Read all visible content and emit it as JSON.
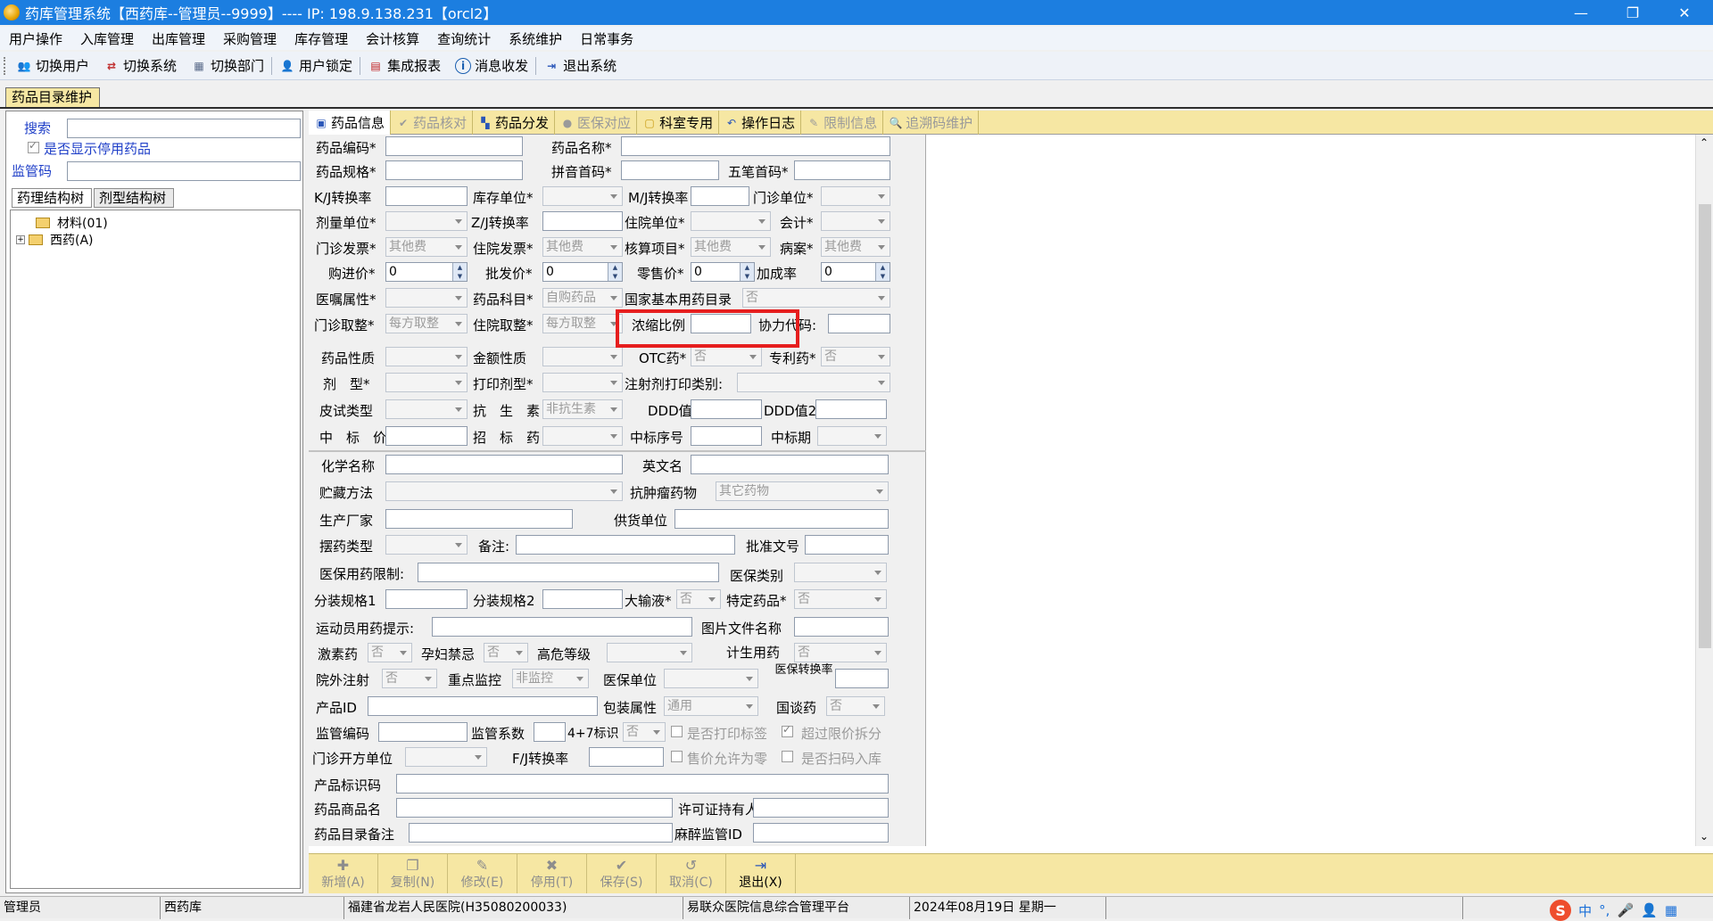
{
  "window": {
    "title": "药库管理系统【西药库--管理员--9999】---- IP: 198.9.138.231【orcl2】",
    "min": "—",
    "restore": "❐",
    "close": "✕"
  },
  "menu": [
    "用户操作",
    "入库管理",
    "出库管理",
    "采购管理",
    "库存管理",
    "会计核算",
    "查询统计",
    "系统维护",
    "日常事务"
  ],
  "toolbar": [
    {
      "label": "切换用户",
      "icon": "users-icon"
    },
    {
      "label": "切换系统",
      "icon": "switch-system-icon"
    },
    {
      "label": "切换部门",
      "icon": "department-icon"
    },
    {
      "label": "用户锁定",
      "icon": "lock-user-icon"
    },
    {
      "label": "集成报表",
      "icon": "report-icon"
    },
    {
      "label": "消息收发",
      "icon": "info-icon"
    },
    {
      "label": "退出系统",
      "icon": "exit-icon"
    }
  ],
  "doc_tab": "药品目录维护",
  "left": {
    "search_label": "搜索",
    "show_disabled_label": "是否显示停用药品",
    "regcode_label": "监管码",
    "tab_pharm": "药理结构树",
    "tab_form": "剂型结构树",
    "tree": [
      "材料(01)",
      "西药(A)"
    ]
  },
  "tabs": [
    {
      "label": "药品信息",
      "state": "active"
    },
    {
      "label": "药品核对",
      "state": "disabled"
    },
    {
      "label": "药品分发",
      "state": "normal"
    },
    {
      "label": "医保对应",
      "state": "disabled"
    },
    {
      "label": "科室专用",
      "state": "normal"
    },
    {
      "label": "操作日志",
      "state": "normal"
    },
    {
      "label": "限制信息",
      "state": "disabled"
    },
    {
      "label": "追溯码维护",
      "state": "disabled"
    }
  ],
  "form": {
    "code": "药品编码*",
    "name": "药品名称*",
    "spec": "药品规格*",
    "pinyin": "拼音首码*",
    "wubi": "五笔首码*",
    "kj": "K/J转换率",
    "stockunit": "库存单位*",
    "mj": "M/J转换率",
    "opunit": "门诊单位*",
    "doseunit": "剂量单位*",
    "zj": "Z/J转换率",
    "ipunit": "住院单位*",
    "acct": "会计*",
    "opinv": "门诊发票*",
    "opinv_val": "其他费",
    "ipinv": "住院发票*",
    "ipinv_val": "其他费",
    "calc": "核算项目*",
    "calc_val": "其他费",
    "case": "病案*",
    "case_val": "其他费",
    "buy": "购进价*",
    "buy_val": "0",
    "whole": "批发价*",
    "whole_val": "0",
    "retail": "零售价*",
    "retail_val": "0",
    "markup": "加成率",
    "markup_val": "0",
    "order": "医嘱属性*",
    "subject": "药品科目*",
    "subject_val": "自购药品",
    "basic": "国家基本用药目录",
    "basic_val": "否",
    "opround": "门诊取整*",
    "opround_val": "每方取整",
    "ipround": "住院取整*",
    "ipround_val": "每方取整",
    "conc": "浓缩比例",
    "cooper": "协力代码:",
    "nature": "药品性质",
    "amount": "金额性质",
    "otc": "OTC药*",
    "otc_val": "否",
    "patent": "专利药*",
    "patent_val": "否",
    "dosage": "剂　型*",
    "printdose": "打印剂型*",
    "inject": "注射剂打印类别:",
    "skin": "皮试类型",
    "anti": "抗　生　素",
    "anti_val": "非抗生素",
    "ddd": "DDD值",
    "ddd2": "DDD值2",
    "bidprice": "中　标　价",
    "bidding": "招　标　药",
    "bidno": "中标序号",
    "bidperiod": "中标期",
    "chem": "化学名称",
    "eng": "英文名",
    "storage": "贮藏方法",
    "tumor": "抗肿瘤药物",
    "tumor_val": "其它药物",
    "maker": "生产厂家",
    "supplier": "供货单位",
    "display": "摆药类型",
    "remark": "备注:",
    "approval": "批准文号",
    "insurance_limit": "医保用药限制:",
    "insurance_cat": "医保类别",
    "pack1": "分装规格1",
    "pack2": "分装规格2",
    "infusion": "大输液*",
    "infusion_val": "否",
    "special": "特定药品*",
    "special_val": "否",
    "athlete": "运动员用药提示:",
    "image": "图片文件名称",
    "hormone": "激素药",
    "hormone_val": "否",
    "pregnant": "孕妇禁忌",
    "pregnant_val": "否",
    "risk": "高危等级",
    "family": "计生用药",
    "family_val": "否",
    "extinj": "院外注射",
    "extinj_val": "否",
    "monitor": "重点监控",
    "monitor_val": "非监控",
    "insunit": "医保单位",
    "insconv": "医保转换率",
    "pid": "产品ID",
    "packattr": "包装属性",
    "packattr_val": "通用",
    "nego": "国谈药",
    "nego_val": "否",
    "regcode": "监管编码",
    "regcoef": "监管系数",
    "mark47": "4+7标识",
    "mark47_val": "否",
    "printlabel": "是否打印标签",
    "overlimit": "超过限价拆分",
    "opunit2": "门诊开方单位",
    "fj": "F/J转换率",
    "zero": "售价允许为零",
    "scanin": "是否扫码入库",
    "prodcode": "产品标识码",
    "trade": "药品商品名",
    "licensee": "许可证持有人",
    "catremark": "药品目录备注",
    "narcotic": "麻醉监管ID"
  },
  "buttons": [
    {
      "label": "新增(A)",
      "icon": "add-icon",
      "enabled": false
    },
    {
      "label": "复制(N)",
      "icon": "copy-icon",
      "enabled": false
    },
    {
      "label": "修改(E)",
      "icon": "edit-icon",
      "enabled": false
    },
    {
      "label": "停用(T)",
      "icon": "disable-icon",
      "enabled": false
    },
    {
      "label": "保存(S)",
      "icon": "save-icon",
      "enabled": false
    },
    {
      "label": "取消(C)",
      "icon": "cancel-icon",
      "enabled": false
    },
    {
      "label": "退出(X)",
      "icon": "exit-icon",
      "enabled": true
    }
  ],
  "status": [
    "管理员",
    "西药库",
    "福建省龙岩人民医院(H35080200033)",
    "易联众医院信息综合管理平台",
    "2024年08月19日 星期一"
  ],
  "ime": {
    "logo": "S",
    "lang": "中"
  },
  "colors": {
    "titlebar": "#1c7ee0",
    "tab_bg": "#f6e7a3",
    "highlight": "#e61e1e",
    "label_blue": "#1f3fc8"
  }
}
